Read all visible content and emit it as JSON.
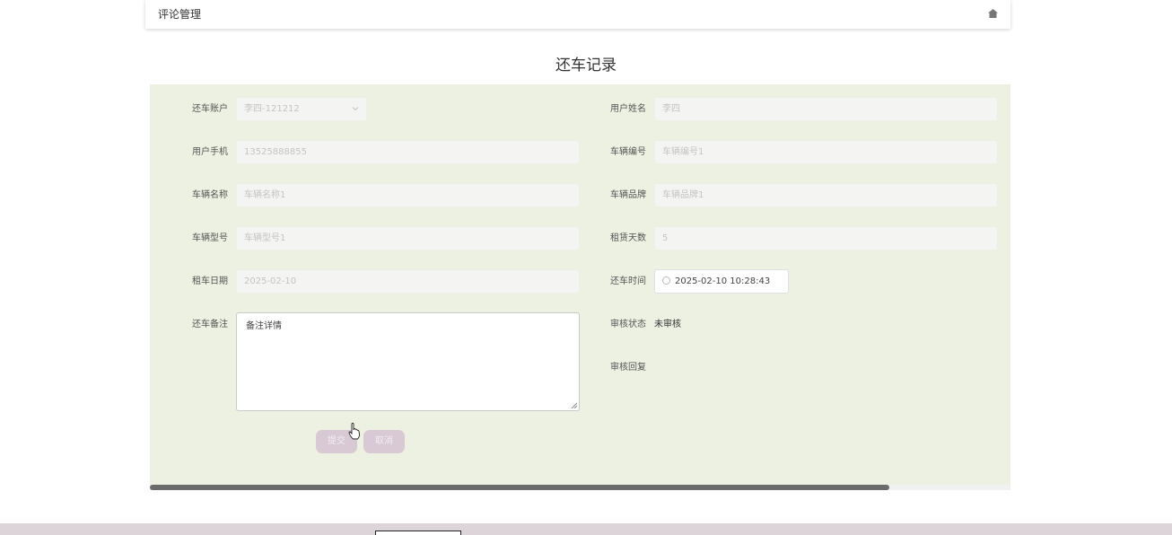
{
  "header": {
    "title": "评论管理",
    "home_icon": "home-icon"
  },
  "page": {
    "title": "还车记录"
  },
  "form": {
    "return_account": {
      "label": "还车账户",
      "value": "李四-121212"
    },
    "user_name": {
      "label": "用户姓名",
      "value": "李四"
    },
    "user_phone": {
      "label": "用户手机",
      "value": "13525888855"
    },
    "car_number": {
      "label": "车辆编号",
      "value": "车辆编号1"
    },
    "car_name": {
      "label": "车辆名称",
      "value": "车辆名称1"
    },
    "car_brand": {
      "label": "车辆品牌",
      "value": "车辆品牌1"
    },
    "car_model": {
      "label": "车辆型号",
      "value": "车辆型号1"
    },
    "rent_days": {
      "label": "租赁天数",
      "value": "5"
    },
    "rent_date": {
      "label": "租车日期",
      "value": "2025-02-10"
    },
    "return_time": {
      "label": "还车时间",
      "value": "2025-02-10 10:28:43"
    },
    "return_note": {
      "label": "还车备注",
      "value": "备注详情"
    },
    "review_status": {
      "label": "审核状态",
      "value": "未审核"
    },
    "review_reply": {
      "label": "审核回复",
      "value": ""
    }
  },
  "buttons": {
    "submit": "提交",
    "cancel": "取消"
  },
  "colors": {
    "panel_bg": "#edf1e2",
    "button_bg": "#d8c9d4",
    "footer_bg": "#ddd4da"
  }
}
